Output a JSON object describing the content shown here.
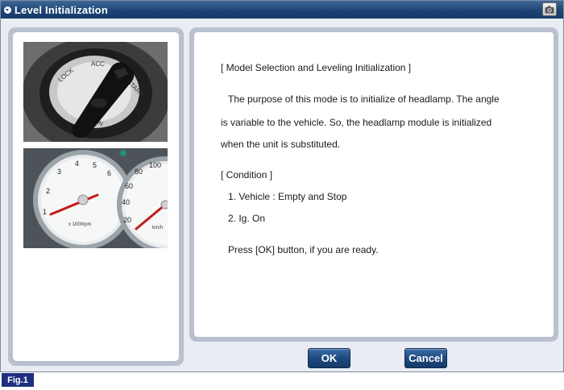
{
  "window": {
    "title": "Level Initialization",
    "camera_icon": "camera-icon"
  },
  "images": {
    "ignition": {
      "icon": "ignition-key-photo",
      "labels": [
        "LOCK",
        "ACC",
        "START",
        "ON"
      ]
    },
    "cluster": {
      "icon": "instrument-cluster-photo",
      "tach_ticks": [
        "1",
        "2",
        "3",
        "4",
        "5",
        "6"
      ],
      "tach_unit": "x 1000rpm",
      "speed_ticks": [
        "20",
        "40",
        "60",
        "80",
        "100"
      ],
      "speed_unit": "km/h"
    }
  },
  "content": {
    "heading": "[ Model Selection and Leveling Initialization ]",
    "para_line1": "The purpose of this mode is to initialize of headlamp.  The angle",
    "para_line2": "is variable to the vehicle.  So, the headlamp module is initialized",
    "para_line3": "when the unit is substituted.",
    "condition_heading": "[ Condition ]",
    "condition_1": "1. Vehicle : Empty and Stop",
    "condition_2": "2. Ig. On",
    "prompt": "Press [OK] button, if you are ready."
  },
  "buttons": {
    "ok_label": "OK",
    "cancel_label": "Cancel"
  },
  "footer": {
    "fig_label": "Fig.1"
  },
  "colors": {
    "titlebar": "#1d4475",
    "panel_frame": "#b9c1cf",
    "button": "#1e4a80",
    "fig_badge": "#1e2f7e"
  }
}
